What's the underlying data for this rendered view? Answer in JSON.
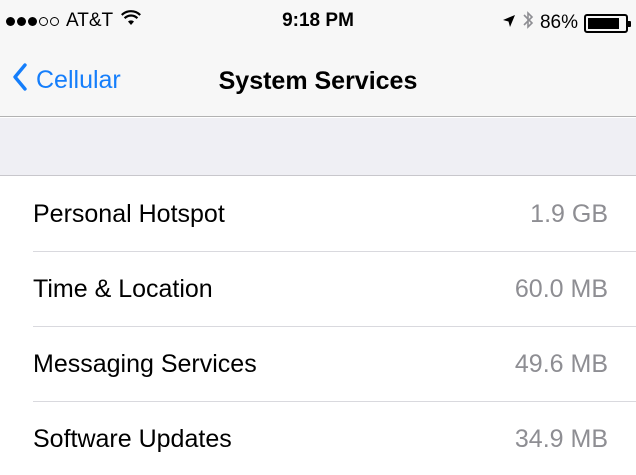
{
  "status_bar": {
    "signal_bars": {
      "filled": 3,
      "total": 5
    },
    "carrier": "AT&T",
    "time": "9:18 PM",
    "battery_percent": "86%",
    "battery_level": 0.86,
    "icons": [
      "wifi-icon",
      "location-arrow-icon",
      "bluetooth-icon",
      "battery-icon"
    ]
  },
  "nav": {
    "back_label": "Cellular",
    "title": "System Services"
  },
  "colors": {
    "accent": "#157efb",
    "secondary_text": "#8e8e93",
    "group_background": "#efeff4"
  },
  "services": [
    {
      "label": "Personal Hotspot",
      "value": "1.9 GB"
    },
    {
      "label": "Time & Location",
      "value": "60.0 MB"
    },
    {
      "label": "Messaging Services",
      "value": "49.6 MB"
    },
    {
      "label": "Software Updates",
      "value": "34.9 MB"
    }
  ]
}
